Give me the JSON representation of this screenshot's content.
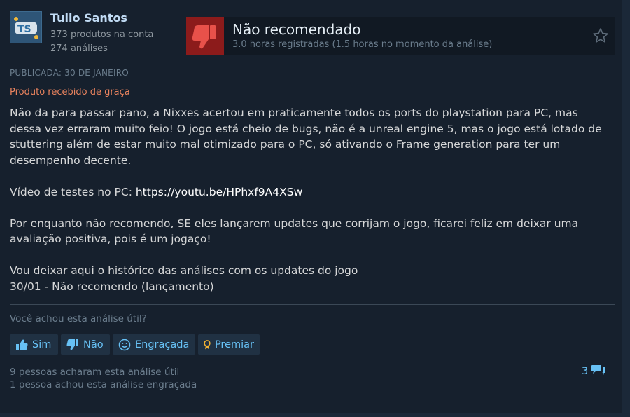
{
  "author": {
    "name": "Tulio Santos",
    "products": "373 produtos na conta",
    "reviews": "274 análises"
  },
  "verdict": {
    "title": "Não recomendado",
    "hours": "3.0 horas registradas (1.5 horas no momento da análise)"
  },
  "posted": "PUBLICADA: 30 DE JANEIRO",
  "received_free": "Produto recebido de graça",
  "body": {
    "p1": "Não da para passar pano, a Nixxes acertou em praticamente todos os ports do playstation para PC, mas dessa vez erraram muito feio! O jogo está cheio de bugs, não é a unreal engine 5, mas o jogo está lotado de stuttering além de estar muito mal otimizado para o PC, só ativando o Frame generation para ter um desempenho decente.",
    "video_prefix": "Vídeo de testes no PC: ",
    "video_link": "https://youtu.be/HPhxf9A4XSw",
    "p3": "Por enquanto não recomendo, SE eles lançarem updates que corrijam o jogo, ficarei feliz em deixar uma avaliação positiva, pois é um jogaço!",
    "p4_line1": "Vou deixar aqui o histórico das análises com os updates do jogo",
    "p4_line2": "30/01 - Não recomendo (lançamento)"
  },
  "feedback": {
    "question": "Você achou esta análise útil?",
    "yes": "Sim",
    "no": "Não",
    "funny": "Engraçada",
    "award": "Premiar"
  },
  "stats": {
    "helpful": "9 pessoas acharam esta análise útil",
    "funny": "1 pessoa achou esta análise engraçada",
    "comments": "3"
  },
  "colors": {
    "background": "#1b2838",
    "not_recommended": "#8c1b1b",
    "link": "#67c1f5",
    "free_product": "#e9835e"
  },
  "icons": {
    "verdict": "thumbs-down-icon",
    "star": "star-icon",
    "yes": "thumbs-up-icon",
    "no": "thumbs-down-icon",
    "funny": "smiley-icon",
    "award": "award-icon",
    "comments": "speech-bubble-icon"
  }
}
